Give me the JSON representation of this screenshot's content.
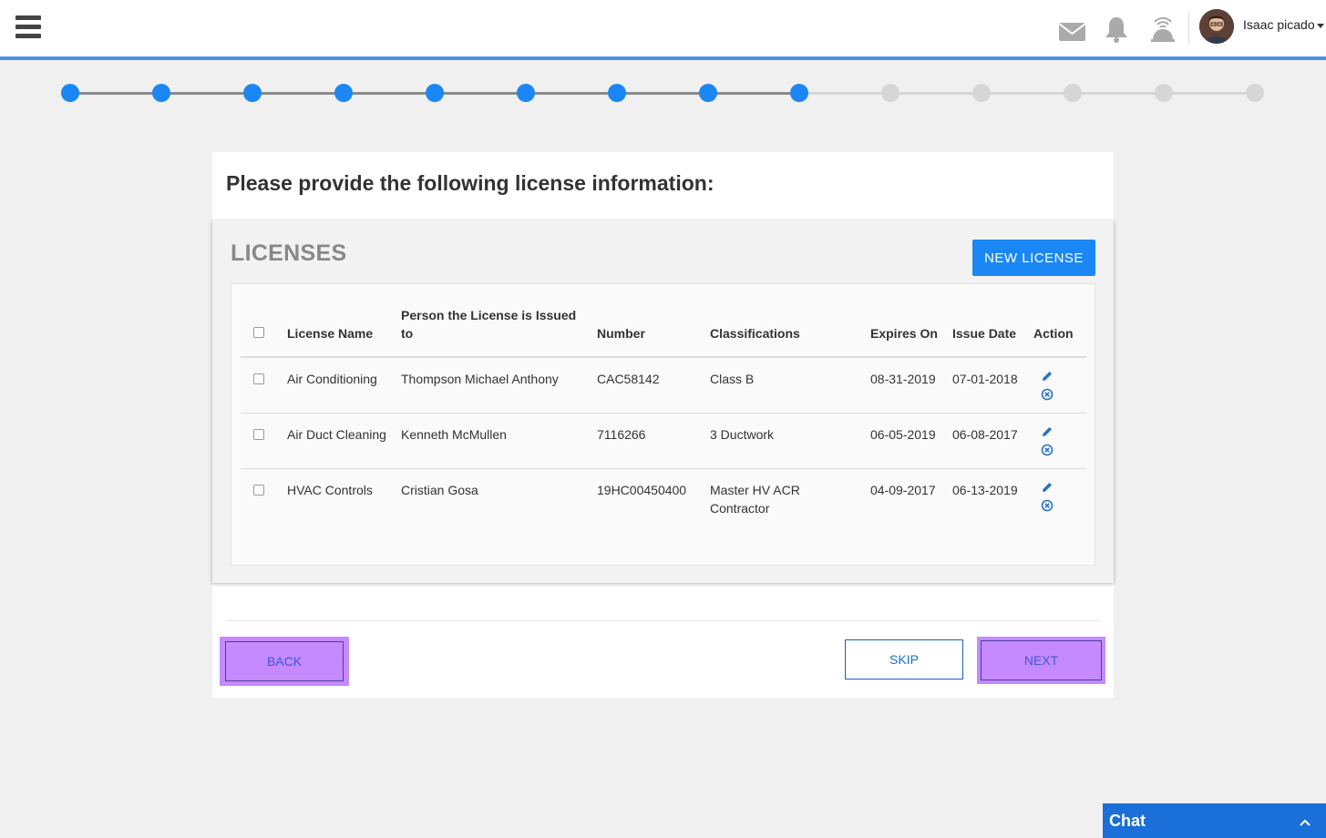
{
  "header": {
    "user_name": "Isaac picado",
    "icons": [
      "menu-icon",
      "mail-icon",
      "bell-icon",
      "signal-icon"
    ]
  },
  "stepper": {
    "total_steps": 14,
    "completed_steps": 9,
    "active_color": "#1b87f5",
    "inactive_color": "#d6d6d6",
    "active_line_color": "#8a8a8a"
  },
  "page": {
    "heading": "Please provide the following license information:"
  },
  "licenses": {
    "title": "LICENSES",
    "new_button": "NEW LICENSE",
    "columns": {
      "name": "License Name",
      "person": "Person the License is Issued to",
      "number": "Number",
      "classifications": "Classifications",
      "expires": "Expires On",
      "issue": "Issue Date",
      "action": "Action"
    },
    "rows": [
      {
        "name": "Air Conditioning",
        "person": "Thompson Michael Anthony",
        "number": "CAC58142",
        "classifications": "Class B",
        "expires": "08-31-2019",
        "issue": "07-01-2018"
      },
      {
        "name": "Air Duct Cleaning",
        "person": "Kenneth McMullen",
        "number": "7116266",
        "classifications": "3 Ductwork",
        "expires": "06-05-2019",
        "issue": "06-08-2017"
      },
      {
        "name": "HVAC Controls",
        "person": "Cristian Gosa",
        "number": "19HC00450400",
        "classifications": "Master HV ACR Contractor",
        "expires": "04-09-2017",
        "issue": "06-13-2019"
      }
    ]
  },
  "footer": {
    "back": "BACK",
    "skip": "SKIP",
    "next": "NEXT"
  },
  "chat": {
    "label": "Chat"
  },
  "colors": {
    "accent": "#1b87f5",
    "highlight": "#c58aff",
    "chat": "#1b6fd8"
  }
}
